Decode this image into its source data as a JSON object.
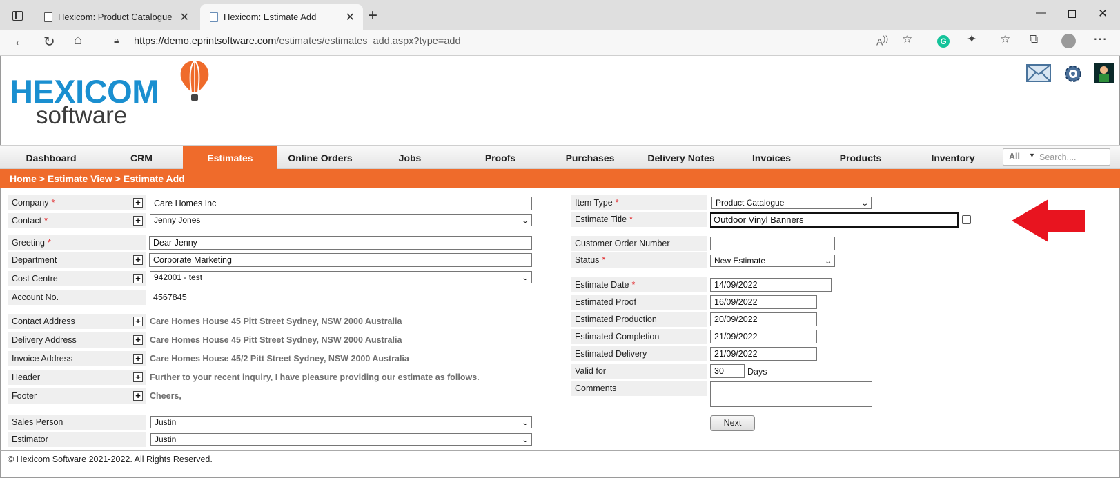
{
  "browser": {
    "tabs": [
      {
        "title": "Hexicom: Product Catalogue"
      },
      {
        "title": "Hexicom: Estimate Add"
      }
    ],
    "url_host": "https://demo.eprintsoftware.com",
    "url_path": "/estimates/estimates_add.aspx?type=add"
  },
  "brand": {
    "name_top": "HEXICOM",
    "name_bottom": "software",
    "primary_color": "#1a8fd0",
    "accent_color": "#ef6b2b"
  },
  "nav": {
    "items": [
      "Dashboard",
      "CRM",
      "Estimates",
      "Online Orders",
      "Jobs",
      "Proofs",
      "Purchases",
      "Delivery Notes",
      "Invoices",
      "Products",
      "Inventory"
    ],
    "active": "Estimates",
    "search_scope": "All",
    "search_placeholder": "Search...."
  },
  "breadcrumb": {
    "home": "Home",
    "sep": ">",
    "view": "Estimate View",
    "current": "Estimate Add"
  },
  "left_form": {
    "company": {
      "label": "Company",
      "value": "Care Homes Inc"
    },
    "contact": {
      "label": "Contact",
      "value": "Jenny Jones"
    },
    "greeting": {
      "label": "Greeting",
      "value": "Dear Jenny"
    },
    "department": {
      "label": "Department",
      "value": "Corporate Marketing"
    },
    "cost_centre": {
      "label": "Cost Centre",
      "value": "942001 - test"
    },
    "account_no": {
      "label": "Account No.",
      "value": "4567845"
    },
    "contact_address": {
      "label": "Contact Address",
      "value": "Care Homes House 45 Pitt Street Sydney, NSW 2000 Australia"
    },
    "delivery_address": {
      "label": "Delivery Address",
      "value": "Care Homes House 45 Pitt Street Sydney, NSW 2000 Australia"
    },
    "invoice_address": {
      "label": "Invoice Address",
      "value": "Care Homes House 45/2 Pitt Street Sydney, NSW 2000 Australia"
    },
    "header": {
      "label": "Header",
      "value": "Further to your recent inquiry, I have pleasure providing our estimate as follows."
    },
    "footer": {
      "label": "Footer",
      "value": "Cheers,"
    },
    "sales_person": {
      "label": "Sales Person",
      "value": "Justin"
    },
    "estimator": {
      "label": "Estimator",
      "value": "Justin"
    }
  },
  "right_form": {
    "item_type": {
      "label": "Item Type",
      "value": "Product Catalogue"
    },
    "estimate_title": {
      "label": "Estimate Title",
      "value": "Outdoor Vinyl Banners"
    },
    "customer_order_number": {
      "label": "Customer Order Number",
      "value": ""
    },
    "status": {
      "label": "Status",
      "value": "New Estimate"
    },
    "estimate_date": {
      "label": "Estimate Date",
      "value": "14/09/2022"
    },
    "estimated_proof": {
      "label": "Estimated Proof",
      "value": "16/09/2022"
    },
    "estimated_production": {
      "label": "Estimated Production",
      "value": "20/09/2022"
    },
    "estimated_completion": {
      "label": "Estimated Completion",
      "value": "21/09/2022"
    },
    "estimated_delivery": {
      "label": "Estimated Delivery",
      "value": "21/09/2022"
    },
    "valid_for": {
      "label": "Valid for",
      "value": "30",
      "unit": "Days"
    },
    "comments": {
      "label": "Comments",
      "value": ""
    },
    "next_label": "Next"
  },
  "required_mark": "*",
  "footer_text": "© Hexicom Software 2021-2022. All Rights Reserved.",
  "annotation_arrow_color": "#e8141f"
}
